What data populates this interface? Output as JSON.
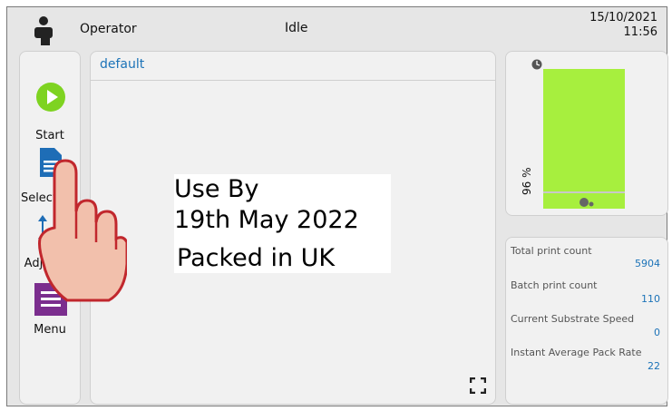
{
  "header": {
    "role": "Operator",
    "status": "Idle",
    "date": "15/10/2021",
    "time": "11:56"
  },
  "sidebar": {
    "items": [
      {
        "label": "Start",
        "icon": "play-icon"
      },
      {
        "label": "Select",
        "icon": "document-icon"
      },
      {
        "label": "Adjust",
        "icon": "adjust-arrows-icon"
      },
      {
        "label": "Menu",
        "icon": "menu-icon"
      }
    ]
  },
  "main": {
    "tab": "default",
    "label_lines": [
      "Use By",
      "19th May 2022",
      "Packed in UK"
    ]
  },
  "gauge": {
    "percent_label": "96 %",
    "level_fraction": 0.96,
    "fill_color": "#a7ef3e"
  },
  "stats": [
    {
      "label": "Total print count",
      "value": "5904"
    },
    {
      "label": "Batch print count",
      "value": "110"
    },
    {
      "label": "Current Substrate Speed",
      "value": "0"
    },
    {
      "label": "Instant Average Pack Rate",
      "value": "22"
    }
  ],
  "colors": {
    "accent": "#1c73b8",
    "start_green": "#7ed321",
    "menu_purple": "#7b2e8e"
  }
}
